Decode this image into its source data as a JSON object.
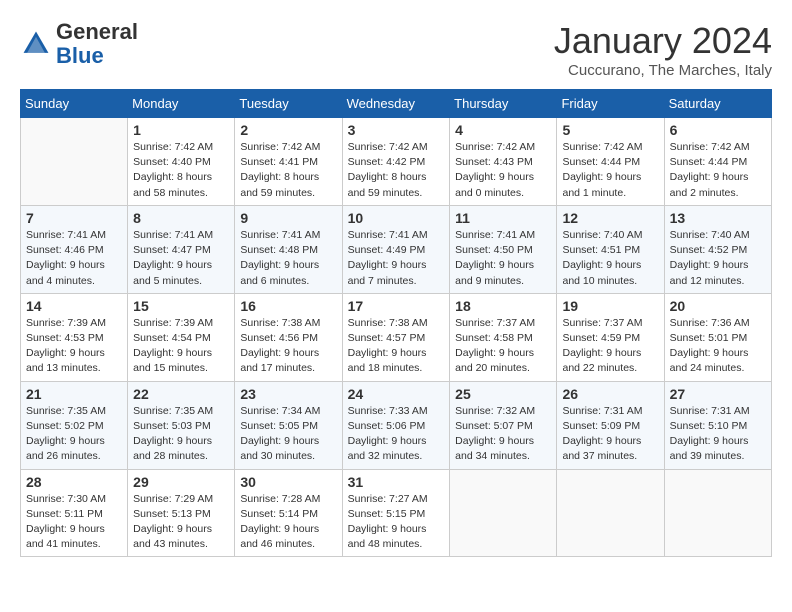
{
  "header": {
    "logo_general": "General",
    "logo_blue": "Blue",
    "month_title": "January 2024",
    "subtitle": "Cuccurano, The Marches, Italy"
  },
  "weekdays": [
    "Sunday",
    "Monday",
    "Tuesday",
    "Wednesday",
    "Thursday",
    "Friday",
    "Saturday"
  ],
  "weeks": [
    [
      {
        "num": "",
        "info": ""
      },
      {
        "num": "1",
        "info": "Sunrise: 7:42 AM\nSunset: 4:40 PM\nDaylight: 8 hours\nand 58 minutes."
      },
      {
        "num": "2",
        "info": "Sunrise: 7:42 AM\nSunset: 4:41 PM\nDaylight: 8 hours\nand 59 minutes."
      },
      {
        "num": "3",
        "info": "Sunrise: 7:42 AM\nSunset: 4:42 PM\nDaylight: 8 hours\nand 59 minutes."
      },
      {
        "num": "4",
        "info": "Sunrise: 7:42 AM\nSunset: 4:43 PM\nDaylight: 9 hours\nand 0 minutes."
      },
      {
        "num": "5",
        "info": "Sunrise: 7:42 AM\nSunset: 4:44 PM\nDaylight: 9 hours\nand 1 minute."
      },
      {
        "num": "6",
        "info": "Sunrise: 7:42 AM\nSunset: 4:44 PM\nDaylight: 9 hours\nand 2 minutes."
      }
    ],
    [
      {
        "num": "7",
        "info": "Sunrise: 7:41 AM\nSunset: 4:46 PM\nDaylight: 9 hours\nand 4 minutes."
      },
      {
        "num": "8",
        "info": "Sunrise: 7:41 AM\nSunset: 4:47 PM\nDaylight: 9 hours\nand 5 minutes."
      },
      {
        "num": "9",
        "info": "Sunrise: 7:41 AM\nSunset: 4:48 PM\nDaylight: 9 hours\nand 6 minutes."
      },
      {
        "num": "10",
        "info": "Sunrise: 7:41 AM\nSunset: 4:49 PM\nDaylight: 9 hours\nand 7 minutes."
      },
      {
        "num": "11",
        "info": "Sunrise: 7:41 AM\nSunset: 4:50 PM\nDaylight: 9 hours\nand 9 minutes."
      },
      {
        "num": "12",
        "info": "Sunrise: 7:40 AM\nSunset: 4:51 PM\nDaylight: 9 hours\nand 10 minutes."
      },
      {
        "num": "13",
        "info": "Sunrise: 7:40 AM\nSunset: 4:52 PM\nDaylight: 9 hours\nand 12 minutes."
      }
    ],
    [
      {
        "num": "14",
        "info": "Sunrise: 7:39 AM\nSunset: 4:53 PM\nDaylight: 9 hours\nand 13 minutes."
      },
      {
        "num": "15",
        "info": "Sunrise: 7:39 AM\nSunset: 4:54 PM\nDaylight: 9 hours\nand 15 minutes."
      },
      {
        "num": "16",
        "info": "Sunrise: 7:38 AM\nSunset: 4:56 PM\nDaylight: 9 hours\nand 17 minutes."
      },
      {
        "num": "17",
        "info": "Sunrise: 7:38 AM\nSunset: 4:57 PM\nDaylight: 9 hours\nand 18 minutes."
      },
      {
        "num": "18",
        "info": "Sunrise: 7:37 AM\nSunset: 4:58 PM\nDaylight: 9 hours\nand 20 minutes."
      },
      {
        "num": "19",
        "info": "Sunrise: 7:37 AM\nSunset: 4:59 PM\nDaylight: 9 hours\nand 22 minutes."
      },
      {
        "num": "20",
        "info": "Sunrise: 7:36 AM\nSunset: 5:01 PM\nDaylight: 9 hours\nand 24 minutes."
      }
    ],
    [
      {
        "num": "21",
        "info": "Sunrise: 7:35 AM\nSunset: 5:02 PM\nDaylight: 9 hours\nand 26 minutes."
      },
      {
        "num": "22",
        "info": "Sunrise: 7:35 AM\nSunset: 5:03 PM\nDaylight: 9 hours\nand 28 minutes."
      },
      {
        "num": "23",
        "info": "Sunrise: 7:34 AM\nSunset: 5:05 PM\nDaylight: 9 hours\nand 30 minutes."
      },
      {
        "num": "24",
        "info": "Sunrise: 7:33 AM\nSunset: 5:06 PM\nDaylight: 9 hours\nand 32 minutes."
      },
      {
        "num": "25",
        "info": "Sunrise: 7:32 AM\nSunset: 5:07 PM\nDaylight: 9 hours\nand 34 minutes."
      },
      {
        "num": "26",
        "info": "Sunrise: 7:31 AM\nSunset: 5:09 PM\nDaylight: 9 hours\nand 37 minutes."
      },
      {
        "num": "27",
        "info": "Sunrise: 7:31 AM\nSunset: 5:10 PM\nDaylight: 9 hours\nand 39 minutes."
      }
    ],
    [
      {
        "num": "28",
        "info": "Sunrise: 7:30 AM\nSunset: 5:11 PM\nDaylight: 9 hours\nand 41 minutes."
      },
      {
        "num": "29",
        "info": "Sunrise: 7:29 AM\nSunset: 5:13 PM\nDaylight: 9 hours\nand 43 minutes."
      },
      {
        "num": "30",
        "info": "Sunrise: 7:28 AM\nSunset: 5:14 PM\nDaylight: 9 hours\nand 46 minutes."
      },
      {
        "num": "31",
        "info": "Sunrise: 7:27 AM\nSunset: 5:15 PM\nDaylight: 9 hours\nand 48 minutes."
      },
      {
        "num": "",
        "info": ""
      },
      {
        "num": "",
        "info": ""
      },
      {
        "num": "",
        "info": ""
      }
    ]
  ]
}
